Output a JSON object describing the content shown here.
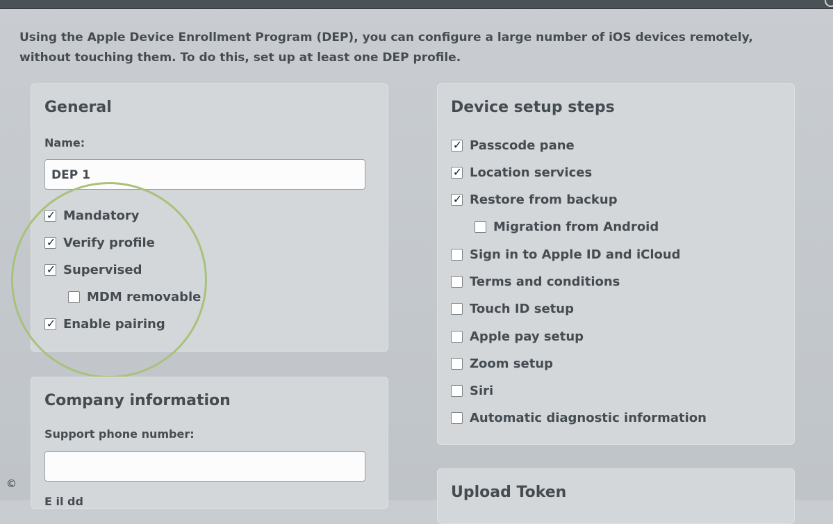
{
  "intro": "Using the Apple Device Enrollment Program (DEP), you can configure a large number of iOS devices remotely, without touching them. To do this, set up at least one DEP profile.",
  "general": {
    "title": "General",
    "name_label": "Name:",
    "name_value": "DEP 1",
    "options": [
      {
        "label": "Mandatory",
        "checked": true
      },
      {
        "label": "Verify profile",
        "checked": true
      },
      {
        "label": "Supervised",
        "checked": true
      },
      {
        "label": "MDM removable",
        "checked": false
      },
      {
        "label": "Enable pairing",
        "checked": true
      }
    ]
  },
  "company": {
    "title": "Company information",
    "phone_label": "Support phone number:",
    "phone_value": "",
    "next_label_partial": "E il dd"
  },
  "setup": {
    "title": "Device setup steps",
    "steps": [
      {
        "label": "Passcode pane",
        "checked": true
      },
      {
        "label": "Location services",
        "checked": true
      },
      {
        "label": "Restore from backup",
        "checked": true
      },
      {
        "label": "Migration from Android",
        "checked": false
      },
      {
        "label": "Sign in to Apple ID and iCloud",
        "checked": false
      },
      {
        "label": "Terms and conditions",
        "checked": false
      },
      {
        "label": "Touch ID setup",
        "checked": false
      },
      {
        "label": "Apple pay setup",
        "checked": false
      },
      {
        "label": "Zoom setup",
        "checked": false
      },
      {
        "label": "Siri",
        "checked": false
      },
      {
        "label": "Automatic diagnostic information",
        "checked": false
      }
    ]
  },
  "upload": {
    "title": "Upload Token"
  },
  "copyright": "©",
  "colors": {
    "highlight_ring": "#a9c17a",
    "panel": "#d3d7da",
    "background": "#c4c8cc"
  }
}
